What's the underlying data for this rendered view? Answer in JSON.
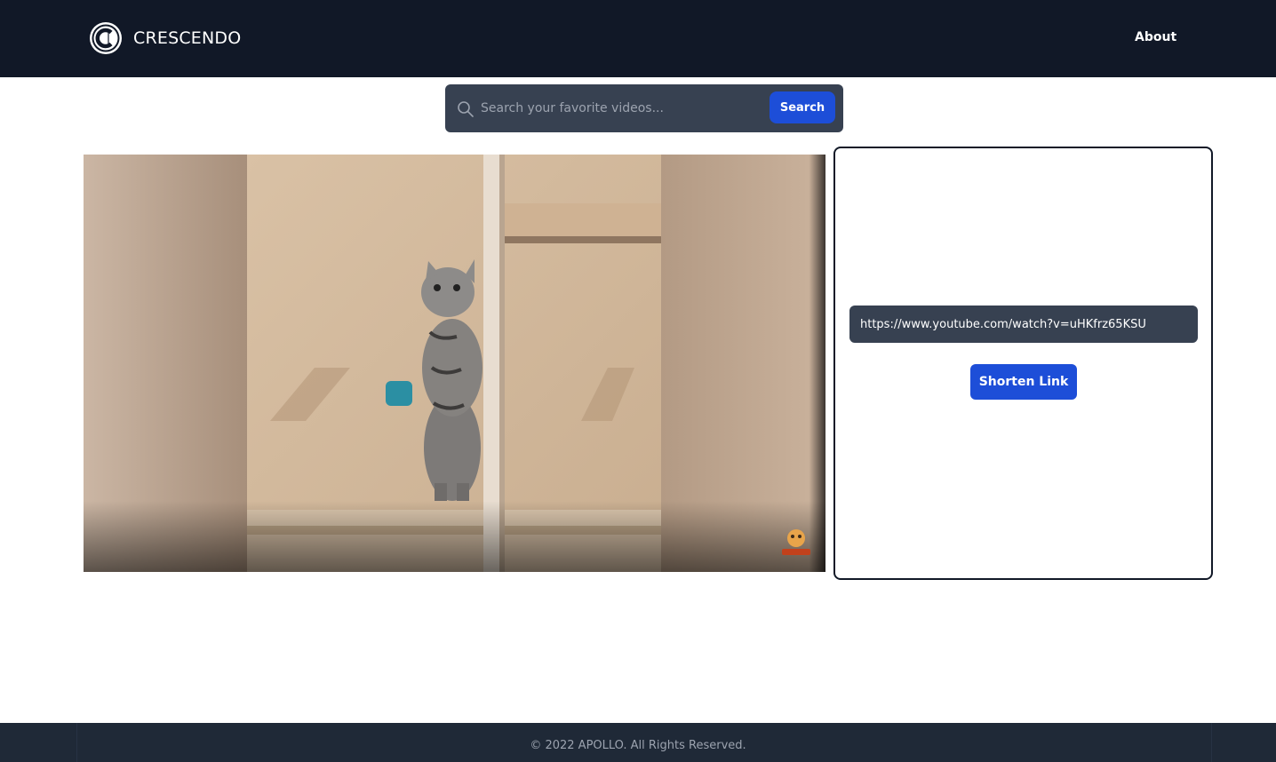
{
  "header": {
    "brand_name": "CRESCENDO",
    "logo_icon": "crescendo-c-logo-icon",
    "nav": {
      "about_label": "About"
    }
  },
  "search": {
    "placeholder": "Search your favorite videos...",
    "button_label": "Search",
    "icon": "search-icon"
  },
  "video": {
    "description": "embedded video frame: kitten standing on hind legs inside a wooden cabinet",
    "watermark": "channel-logo-icon"
  },
  "shortener": {
    "url_value": "https://www.youtube.com/watch?v=uHKfrz65KSU",
    "button_label": "Shorten Link"
  },
  "footer": {
    "copyright": "© 2022 APOLLO. All Rights Reserved."
  },
  "colors": {
    "navbar_bg": "#111827",
    "accent": "#1d4ed8",
    "input_bg": "#374151",
    "footer_bg": "#1f2937"
  }
}
